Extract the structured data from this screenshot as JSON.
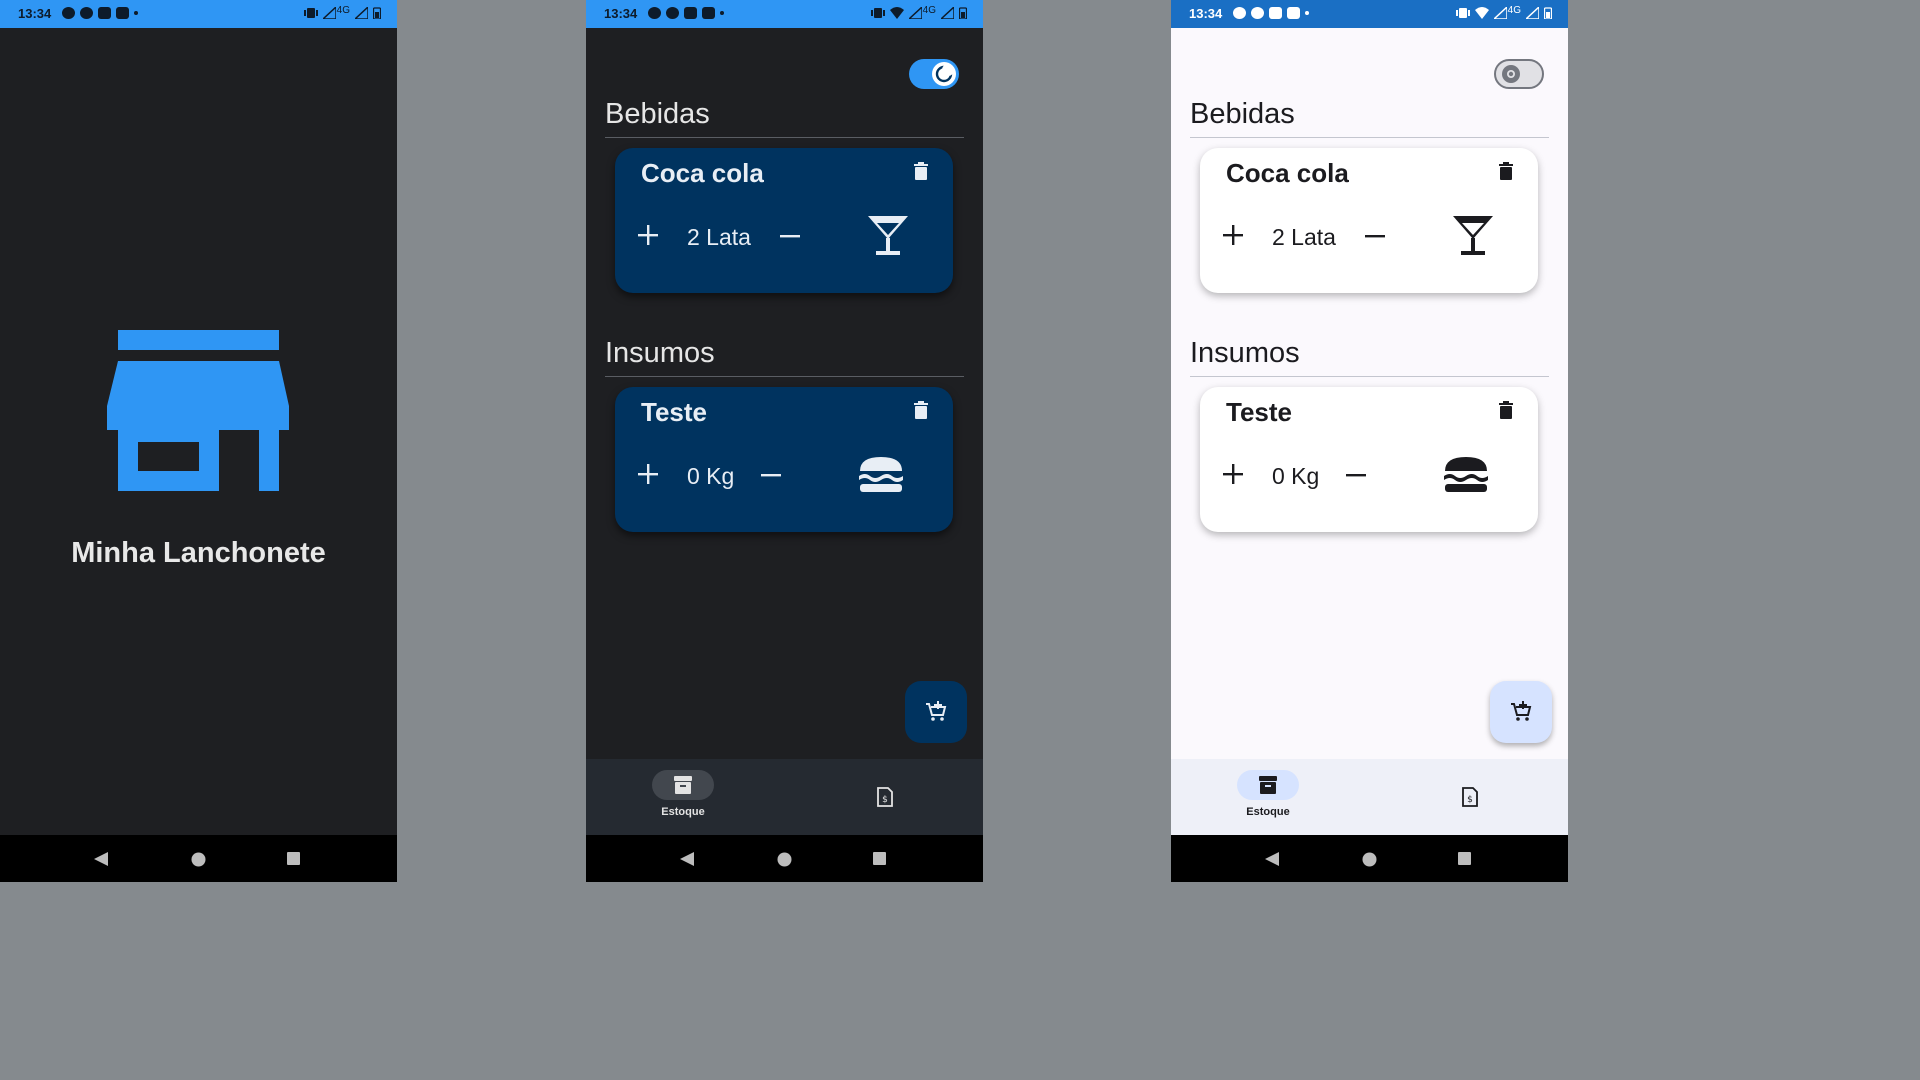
{
  "status_bar": {
    "time": "13:34",
    "network": "4G"
  },
  "splash": {
    "app_name": "Minha Lanchonete"
  },
  "inventory": {
    "sections": [
      {
        "title": "Bebidas",
        "items": [
          {
            "name": "Coca cola",
            "quantity": "2 Lata",
            "icon": "cocktail-icon"
          }
        ]
      },
      {
        "title": "Insumos",
        "items": [
          {
            "name": "Teste",
            "quantity": "0 Kg",
            "icon": "hamburger-icon"
          }
        ]
      }
    ],
    "theme_toggle": {
      "dark_mode_on": true
    },
    "fab": {
      "icon": "add-shopping-cart-icon"
    },
    "bottom_nav": [
      {
        "label": "Estoque",
        "icon": "inventory-box-icon",
        "selected": true
      },
      {
        "label": "",
        "icon": "receipt-icon",
        "selected": false
      }
    ]
  },
  "colors": {
    "status_bar": "#2f96f4",
    "brand_blue": "#2f96f4",
    "dark_background": "#1e1f22",
    "dark_card": "#00335f",
    "light_background": "#fbf9fd",
    "light_card": "#ffffff",
    "light_fab": "#d6e3ff"
  }
}
